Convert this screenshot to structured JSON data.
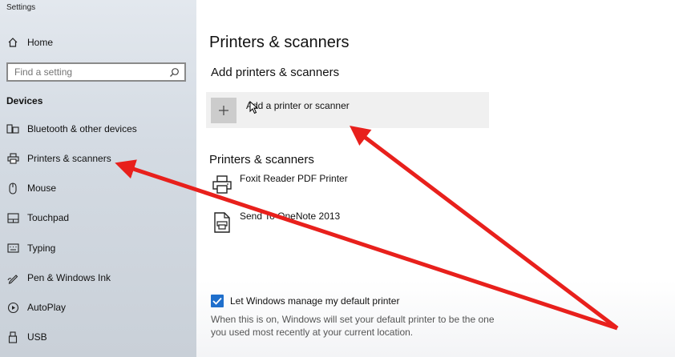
{
  "window": {
    "title": "Settings"
  },
  "sidebar": {
    "home_label": "Home",
    "search_placeholder": "Find a setting",
    "section_label": "Devices",
    "items": [
      {
        "label": "Bluetooth & other devices",
        "icon": "bluetooth-devices-icon"
      },
      {
        "label": "Printers & scanners",
        "icon": "printer-icon"
      },
      {
        "label": "Mouse",
        "icon": "mouse-icon"
      },
      {
        "label": "Touchpad",
        "icon": "touchpad-icon"
      },
      {
        "label": "Typing",
        "icon": "keyboard-icon"
      },
      {
        "label": "Pen & Windows Ink",
        "icon": "pen-icon"
      },
      {
        "label": "AutoPlay",
        "icon": "autoplay-icon"
      },
      {
        "label": "USB",
        "icon": "usb-icon"
      }
    ]
  },
  "main": {
    "title": "Printers & scanners",
    "add_section_title": "Add printers & scanners",
    "add_button_label": "Add a printer or scanner",
    "list_section_title": "Printers & scanners",
    "printers": [
      {
        "name": "Foxit Reader PDF Printer",
        "icon": "printer-icon"
      },
      {
        "name": "Send To OneNote 2013",
        "icon": "document-printer-icon"
      }
    ],
    "default_checkbox_label": "Let Windows manage my default printer",
    "default_checkbox_checked": true,
    "default_description": "When this is on, Windows will set your default printer to be the one you used most recently at your current location."
  },
  "colors": {
    "accent": "#1f6fcc",
    "arrow": "#e8201c"
  }
}
